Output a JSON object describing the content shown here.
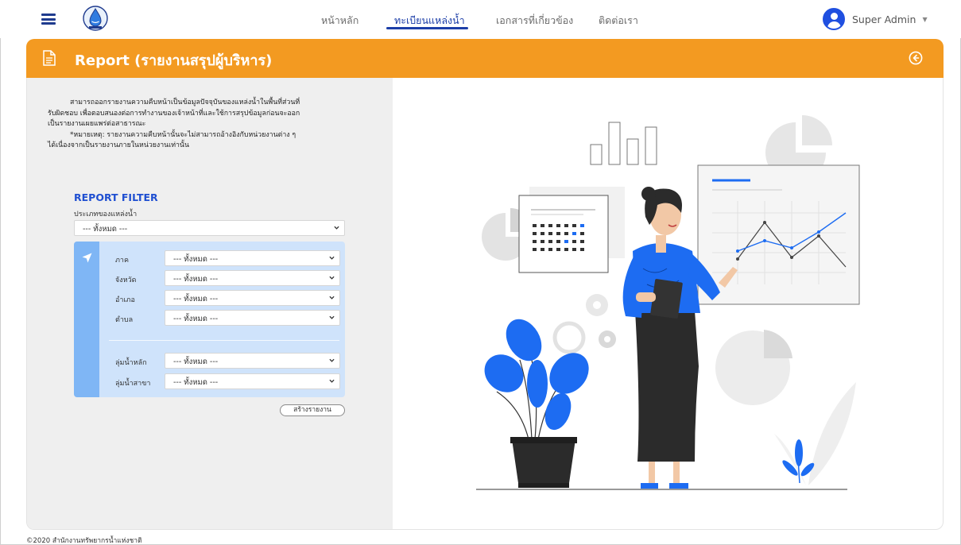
{
  "nav": {
    "menu": [
      "หน้าหลัก",
      "ทะเบียนแหล่งน้ำ",
      "เอกสารที่เกี่ยวข้อง",
      "ติดต่อเรา"
    ],
    "active_index": 1,
    "user_name": "Super Admin"
  },
  "header": {
    "title": "Report (รายงานสรุปผู้บริหาร)",
    "accent": "#f39a21"
  },
  "description": {
    "line1": "สามารถออกรายงานความคืบหน้าเป็นข้อมูลปัจจุบันของแหล่งน้ำในพื้นที่ส่วนที่",
    "line2": "รับผิดชอบ เพื่อตอบสนองต่อการทำงานของเจ้าหน้าที่และใช้การสรุปข้อมูลก่อนจะออก",
    "line3": "เป็นรายงานเผยแพร่ต่อสาธารณะ",
    "line4": "*หมายเหตุ: รายงานความคืบหน้านั้นจะไม่สามารถอ้างอิงกับหน่วยงานต่าง ๆ",
    "line5": "ได้เนื่องจากเป็นรายงานภายในหน่วยงานเท่านั้น"
  },
  "filter": {
    "title": "REPORT FILTER",
    "water_source_type_label": "ประเภทของแหล่งน้ำ",
    "water_source_type_value": "--- ทั้งหมด ---",
    "fields": [
      {
        "label": "ภาค",
        "value": "--- ทั้งหมด ---"
      },
      {
        "label": "จังหวัด",
        "value": "--- ทั้งหมด ---"
      },
      {
        "label": "อำเภอ",
        "value": "--- ทั้งหมด ---"
      },
      {
        "label": "ตำบล",
        "value": "--- ทั้งหมด ---"
      },
      {
        "label": "ลุ่มน้ำหลัก",
        "value": "--- ทั้งหมด ---"
      },
      {
        "label": "ลุ่มน้ำสาขา",
        "value": "--- ทั้งหมด ---"
      }
    ],
    "submit_label": "สร้างรายงาน",
    "panel_color": "#cfe3fb"
  },
  "footer": {
    "text": "©2020 สำนักงานทรัพยากรน้ำแห่งชาติ"
  },
  "colors": {
    "brand_blue": "#1c3ea8",
    "illustration_blue": "#1d6cf2"
  }
}
